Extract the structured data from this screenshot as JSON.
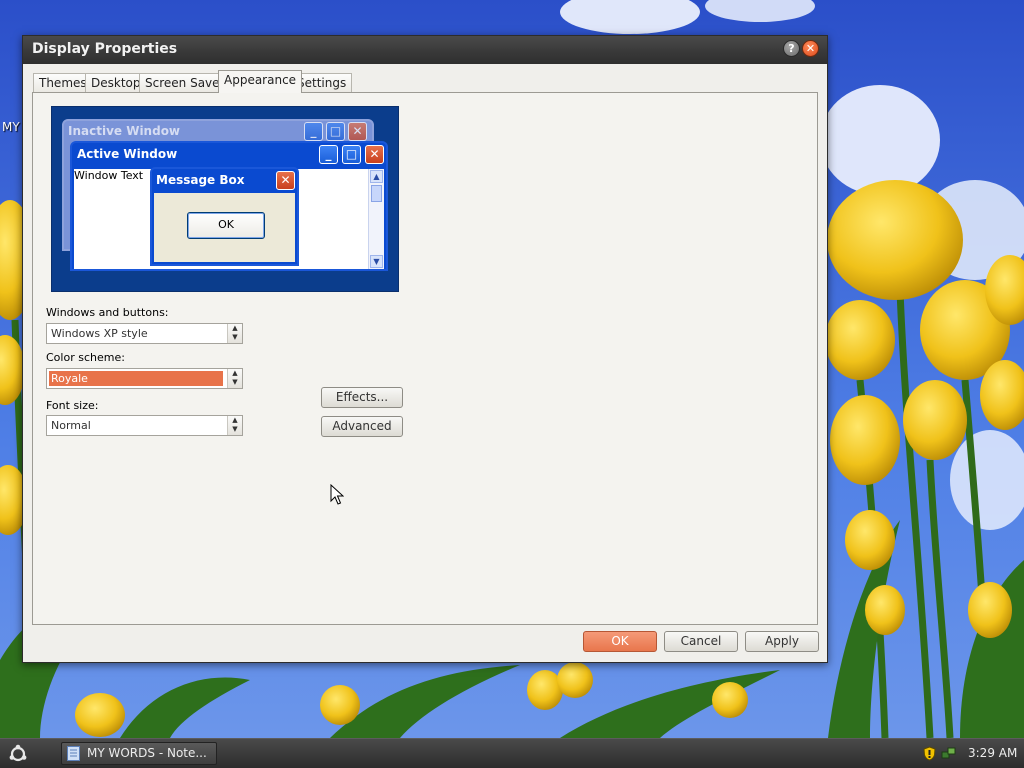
{
  "desktop": {
    "label": "MY"
  },
  "dialog": {
    "title": "Display Properties",
    "help_glyph": "?",
    "close_glyph": "✕",
    "tabs": [
      {
        "label": "Themes"
      },
      {
        "label": "Desktop"
      },
      {
        "label": "Screen Saver"
      },
      {
        "label": "Appearance",
        "active": true
      },
      {
        "label": "Settings"
      }
    ],
    "preview": {
      "inactive_title": "Inactive Window",
      "active_title": "Active Window",
      "window_text": "Window Text",
      "message_title": "Message Box",
      "ok_label": "OK"
    },
    "fields": {
      "windows_buttons": {
        "label": "Windows and buttons:",
        "value": "Windows XP style"
      },
      "color_scheme": {
        "label": "Color scheme:",
        "value": "Royale"
      },
      "font_size": {
        "label": "Font size:",
        "value": "Normal"
      }
    },
    "buttons": {
      "effects": "Effects...",
      "advanced": "Advanced",
      "ok": "OK",
      "cancel": "Cancel",
      "apply": "Apply"
    }
  },
  "taskbar": {
    "task_label": "MY WORDS - Note...",
    "clock": "3:29 AM"
  },
  "colors": {
    "accent": "#e8764c",
    "preview_blue": "#0a4ad0"
  }
}
